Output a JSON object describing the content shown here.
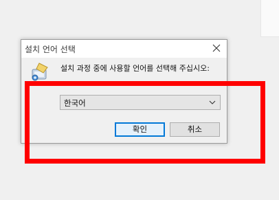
{
  "dialog": {
    "title": "설치 언어 선택",
    "message": "설치 과정 중에 사용할 언어를 선택해 주십시오:",
    "language_select": {
      "value": "한국어"
    },
    "ok_label": "확인",
    "cancel_label": "취소"
  },
  "icons": {
    "close": "close-icon",
    "app": "installer-icon",
    "dropdown": "chevron-down-icon"
  },
  "colors": {
    "highlight": "#ff0000",
    "focus_border": "#0078d7"
  }
}
